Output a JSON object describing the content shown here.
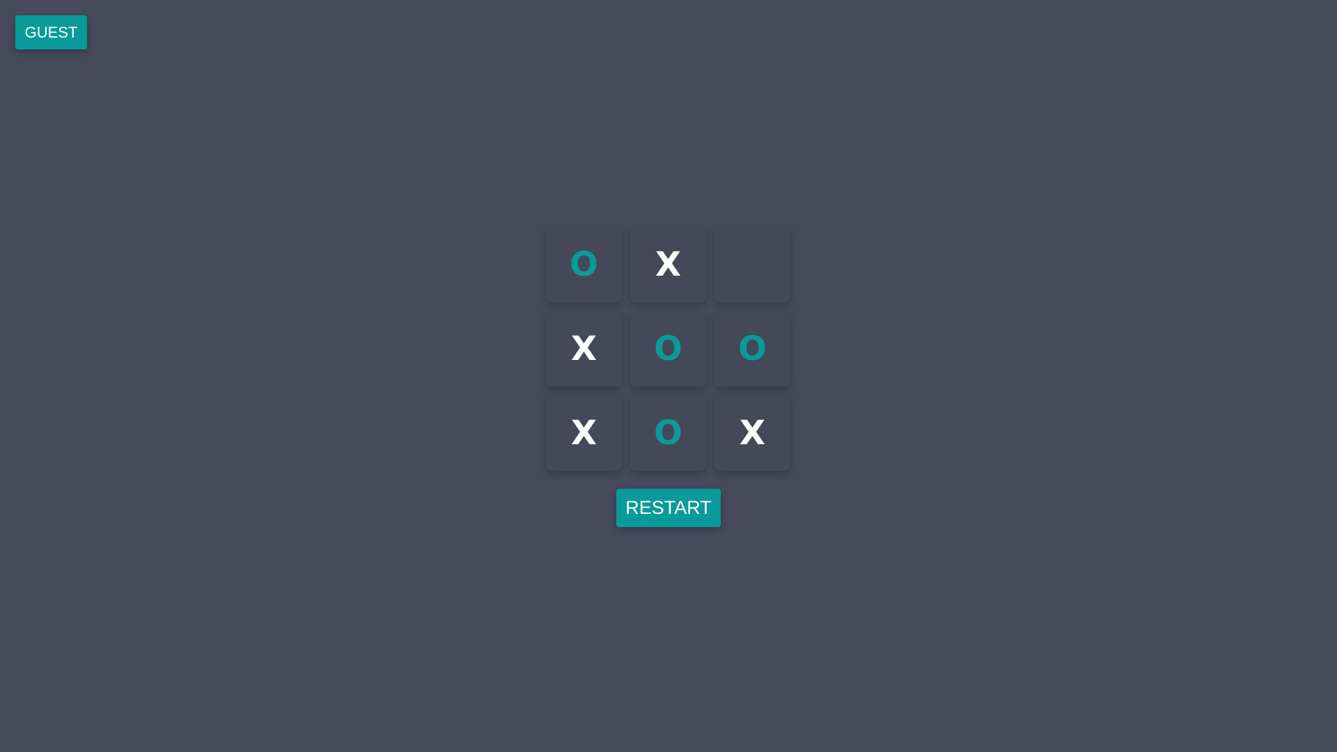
{
  "header": {
    "guest_label": "GUEST"
  },
  "board": {
    "cells": [
      "O",
      "X",
      "",
      "X",
      "O",
      "O",
      "X",
      "O",
      "X"
    ]
  },
  "controls": {
    "restart_label": "RESTART"
  },
  "colors": {
    "background": "#464a5c",
    "cell_background": "#454858",
    "accent": "#0a9a9a",
    "x_mark": "#ffffff",
    "o_mark": "#0a9a9a"
  }
}
